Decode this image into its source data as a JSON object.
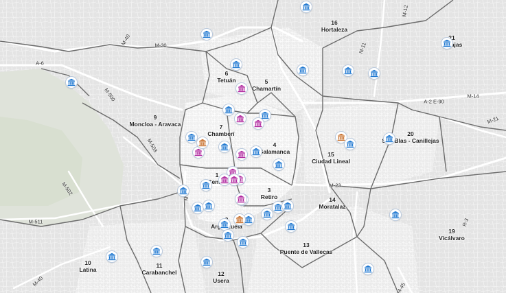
{
  "map": {
    "colors": {
      "land": "#e6e6e6",
      "center": "#f1f1f1",
      "streets": "#ffffff",
      "boundary": "#666666",
      "park": "#dbe3d5",
      "museum_blue": "#1f78d1",
      "museum_magenta": "#b0289f",
      "museum_orange": "#c8702c"
    },
    "districts": [
      {
        "number": "1",
        "name": "Centro",
        "icon": "district-label"
      },
      {
        "number": "2",
        "name": "Arganzuela"
      },
      {
        "number": "3",
        "name": "Retiro"
      },
      {
        "number": "4",
        "name": "Salamanca"
      },
      {
        "number": "5",
        "name": "Chamartín"
      },
      {
        "number": "6",
        "name": "Tetuán"
      },
      {
        "number": "7",
        "name": "Chamberí"
      },
      {
        "number": "9",
        "name": "Moncloa - Aravaca"
      },
      {
        "number": "10",
        "name": "Latina"
      },
      {
        "number": "11",
        "name": "Carabanchel"
      },
      {
        "number": "12",
        "name": "Usera"
      },
      {
        "number": "13",
        "name": "Puente de Vallecas"
      },
      {
        "number": "14",
        "name": "Moratalaz"
      },
      {
        "number": "15",
        "name": "Ciudad Lineal"
      },
      {
        "number": "16",
        "name": "Hortaleza"
      },
      {
        "number": "19",
        "name": "Vicálvaro"
      },
      {
        "number": "20",
        "name": "San Blas - Canillejas"
      },
      {
        "number": "21",
        "name": "Barajas"
      }
    ],
    "roads": [
      "M-40",
      "M-30",
      "A-6",
      "M-500",
      "M-503",
      "M-502",
      "M-511",
      "M-12",
      "M-11",
      "M-14",
      "A-2 E-90",
      "M-21",
      "M-23",
      "R-3",
      "M-45",
      "M-30",
      "M-40"
    ],
    "markers": [
      {
        "type": "museum",
        "color": "blue"
      },
      {
        "type": "museum",
        "color": "blue"
      },
      {
        "type": "museum",
        "color": "blue"
      },
      {
        "type": "museum",
        "color": "blue"
      },
      {
        "type": "museum",
        "color": "blue"
      },
      {
        "type": "museum",
        "color": "blue"
      },
      {
        "type": "museum",
        "color": "blue"
      },
      {
        "type": "museum",
        "color": "blue"
      },
      {
        "type": "museum",
        "color": "magenta"
      },
      {
        "type": "museum",
        "color": "blue"
      },
      {
        "type": "museum",
        "color": "magenta"
      },
      {
        "type": "museum",
        "color": "magenta"
      },
      {
        "type": "museum",
        "color": "blue"
      },
      {
        "type": "museum",
        "color": "magenta"
      },
      {
        "type": "museum",
        "color": "orange"
      },
      {
        "type": "museum",
        "color": "blue"
      },
      {
        "type": "museum",
        "color": "blue"
      },
      {
        "type": "museum",
        "color": "magenta"
      },
      {
        "type": "museum",
        "color": "blue"
      },
      {
        "type": "museum",
        "color": "orange"
      },
      {
        "type": "museum",
        "color": "blue"
      },
      {
        "type": "museum",
        "color": "blue"
      },
      {
        "type": "museum",
        "color": "magenta"
      },
      {
        "type": "museum",
        "color": "magenta"
      },
      {
        "type": "museum",
        "color": "magenta"
      },
      {
        "type": "museum",
        "color": "magenta"
      },
      {
        "type": "museum",
        "color": "blue"
      },
      {
        "type": "museum",
        "color": "blue"
      },
      {
        "type": "museum",
        "color": "blue"
      },
      {
        "type": "museum",
        "color": "blue"
      },
      {
        "type": "museum",
        "color": "magenta"
      },
      {
        "type": "museum",
        "color": "blue"
      },
      {
        "type": "museum",
        "color": "blue"
      },
      {
        "type": "museum",
        "color": "blue"
      },
      {
        "type": "museum",
        "color": "blue"
      },
      {
        "type": "museum",
        "color": "orange"
      },
      {
        "type": "museum",
        "color": "blue"
      },
      {
        "type": "museum",
        "color": "blue"
      },
      {
        "type": "museum",
        "color": "magenta"
      },
      {
        "type": "museum",
        "color": "blue"
      },
      {
        "type": "museum",
        "color": "blue"
      },
      {
        "type": "museum",
        "color": "blue"
      },
      {
        "type": "museum",
        "color": "blue"
      },
      {
        "type": "museum",
        "color": "blue"
      },
      {
        "type": "museum",
        "color": "blue"
      },
      {
        "type": "museum",
        "color": "blue"
      },
      {
        "type": "museum",
        "color": "blue"
      }
    ]
  }
}
